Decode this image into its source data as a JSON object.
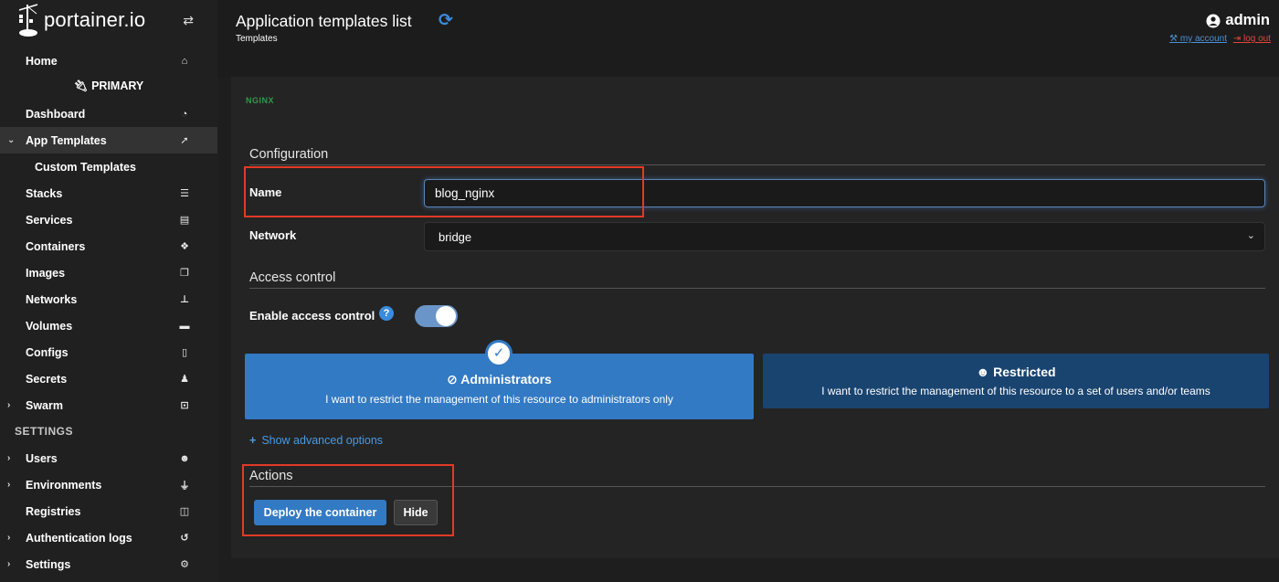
{
  "sidebar": {
    "brand": "portainer.io",
    "environment": "PRIMARY",
    "settings_heading": "SETTINGS",
    "items": [
      {
        "label": "Home",
        "icon": "home-icon"
      },
      {
        "label": "Dashboard",
        "icon": "tachometer-icon"
      },
      {
        "label": "App Templates",
        "icon": "rocket-icon"
      },
      {
        "label": "Custom Templates",
        "icon": ""
      },
      {
        "label": "Stacks",
        "icon": "th-list-icon"
      },
      {
        "label": "Services",
        "icon": "list-alt-icon"
      },
      {
        "label": "Containers",
        "icon": "cubes-icon"
      },
      {
        "label": "Images",
        "icon": "clone-icon"
      },
      {
        "label": "Networks",
        "icon": "sitemap-icon"
      },
      {
        "label": "Volumes",
        "icon": "hdd-icon"
      },
      {
        "label": "Configs",
        "icon": "file-code-icon"
      },
      {
        "label": "Secrets",
        "icon": "user-secret-icon"
      },
      {
        "label": "Swarm",
        "icon": "object-group-icon"
      },
      {
        "label": "Users",
        "icon": "users-icon"
      },
      {
        "label": "Environments",
        "icon": "plug-icon"
      },
      {
        "label": "Registries",
        "icon": "database-icon"
      },
      {
        "label": "Authentication logs",
        "icon": "history-icon"
      },
      {
        "label": "Settings",
        "icon": "cogs-icon"
      }
    ]
  },
  "header": {
    "title": "Application templates list",
    "breadcrumb": "Templates",
    "user": "admin",
    "my_account": "my account",
    "log_out": "log out"
  },
  "template": {
    "logo_text": "NGINX"
  },
  "configuration": {
    "heading": "Configuration",
    "name_label": "Name",
    "name_value": "blog_nginx",
    "network_label": "Network",
    "network_value": "bridge"
  },
  "access_control": {
    "heading": "Access control",
    "enable_label": "Enable access control",
    "enabled": true,
    "admin_title": "Administrators",
    "admin_desc": "I want to restrict the management of this resource to administrators only",
    "restricted_title": "Restricted",
    "restricted_desc": "I want to restrict the management of this resource to a set of users and/or teams",
    "advanced_link": "Show advanced options"
  },
  "actions": {
    "heading": "Actions",
    "deploy_label": "Deploy the container",
    "hide_label": "Hide"
  },
  "colors": {
    "accent": "#337ac4",
    "highlight": "#e23a26",
    "nginx_green": "#2e9b49"
  }
}
